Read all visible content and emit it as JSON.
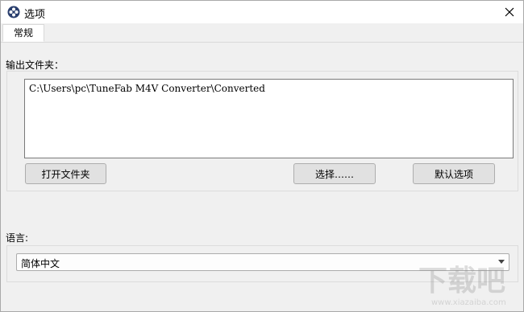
{
  "window": {
    "title": "选项",
    "close_icon": "close-icon",
    "app_icon": "app-logo-icon"
  },
  "tabs": [
    {
      "label": "常规",
      "active": true
    }
  ],
  "output": {
    "label": "输出文件夹：",
    "path": "C:\\Users\\pc\\TuneFab M4V Converter\\Converted",
    "open_button": "打开文件夹",
    "choose_button": "选择……",
    "default_button": "默认选项"
  },
  "language": {
    "label": "语言:",
    "selected": "简体中文"
  }
}
